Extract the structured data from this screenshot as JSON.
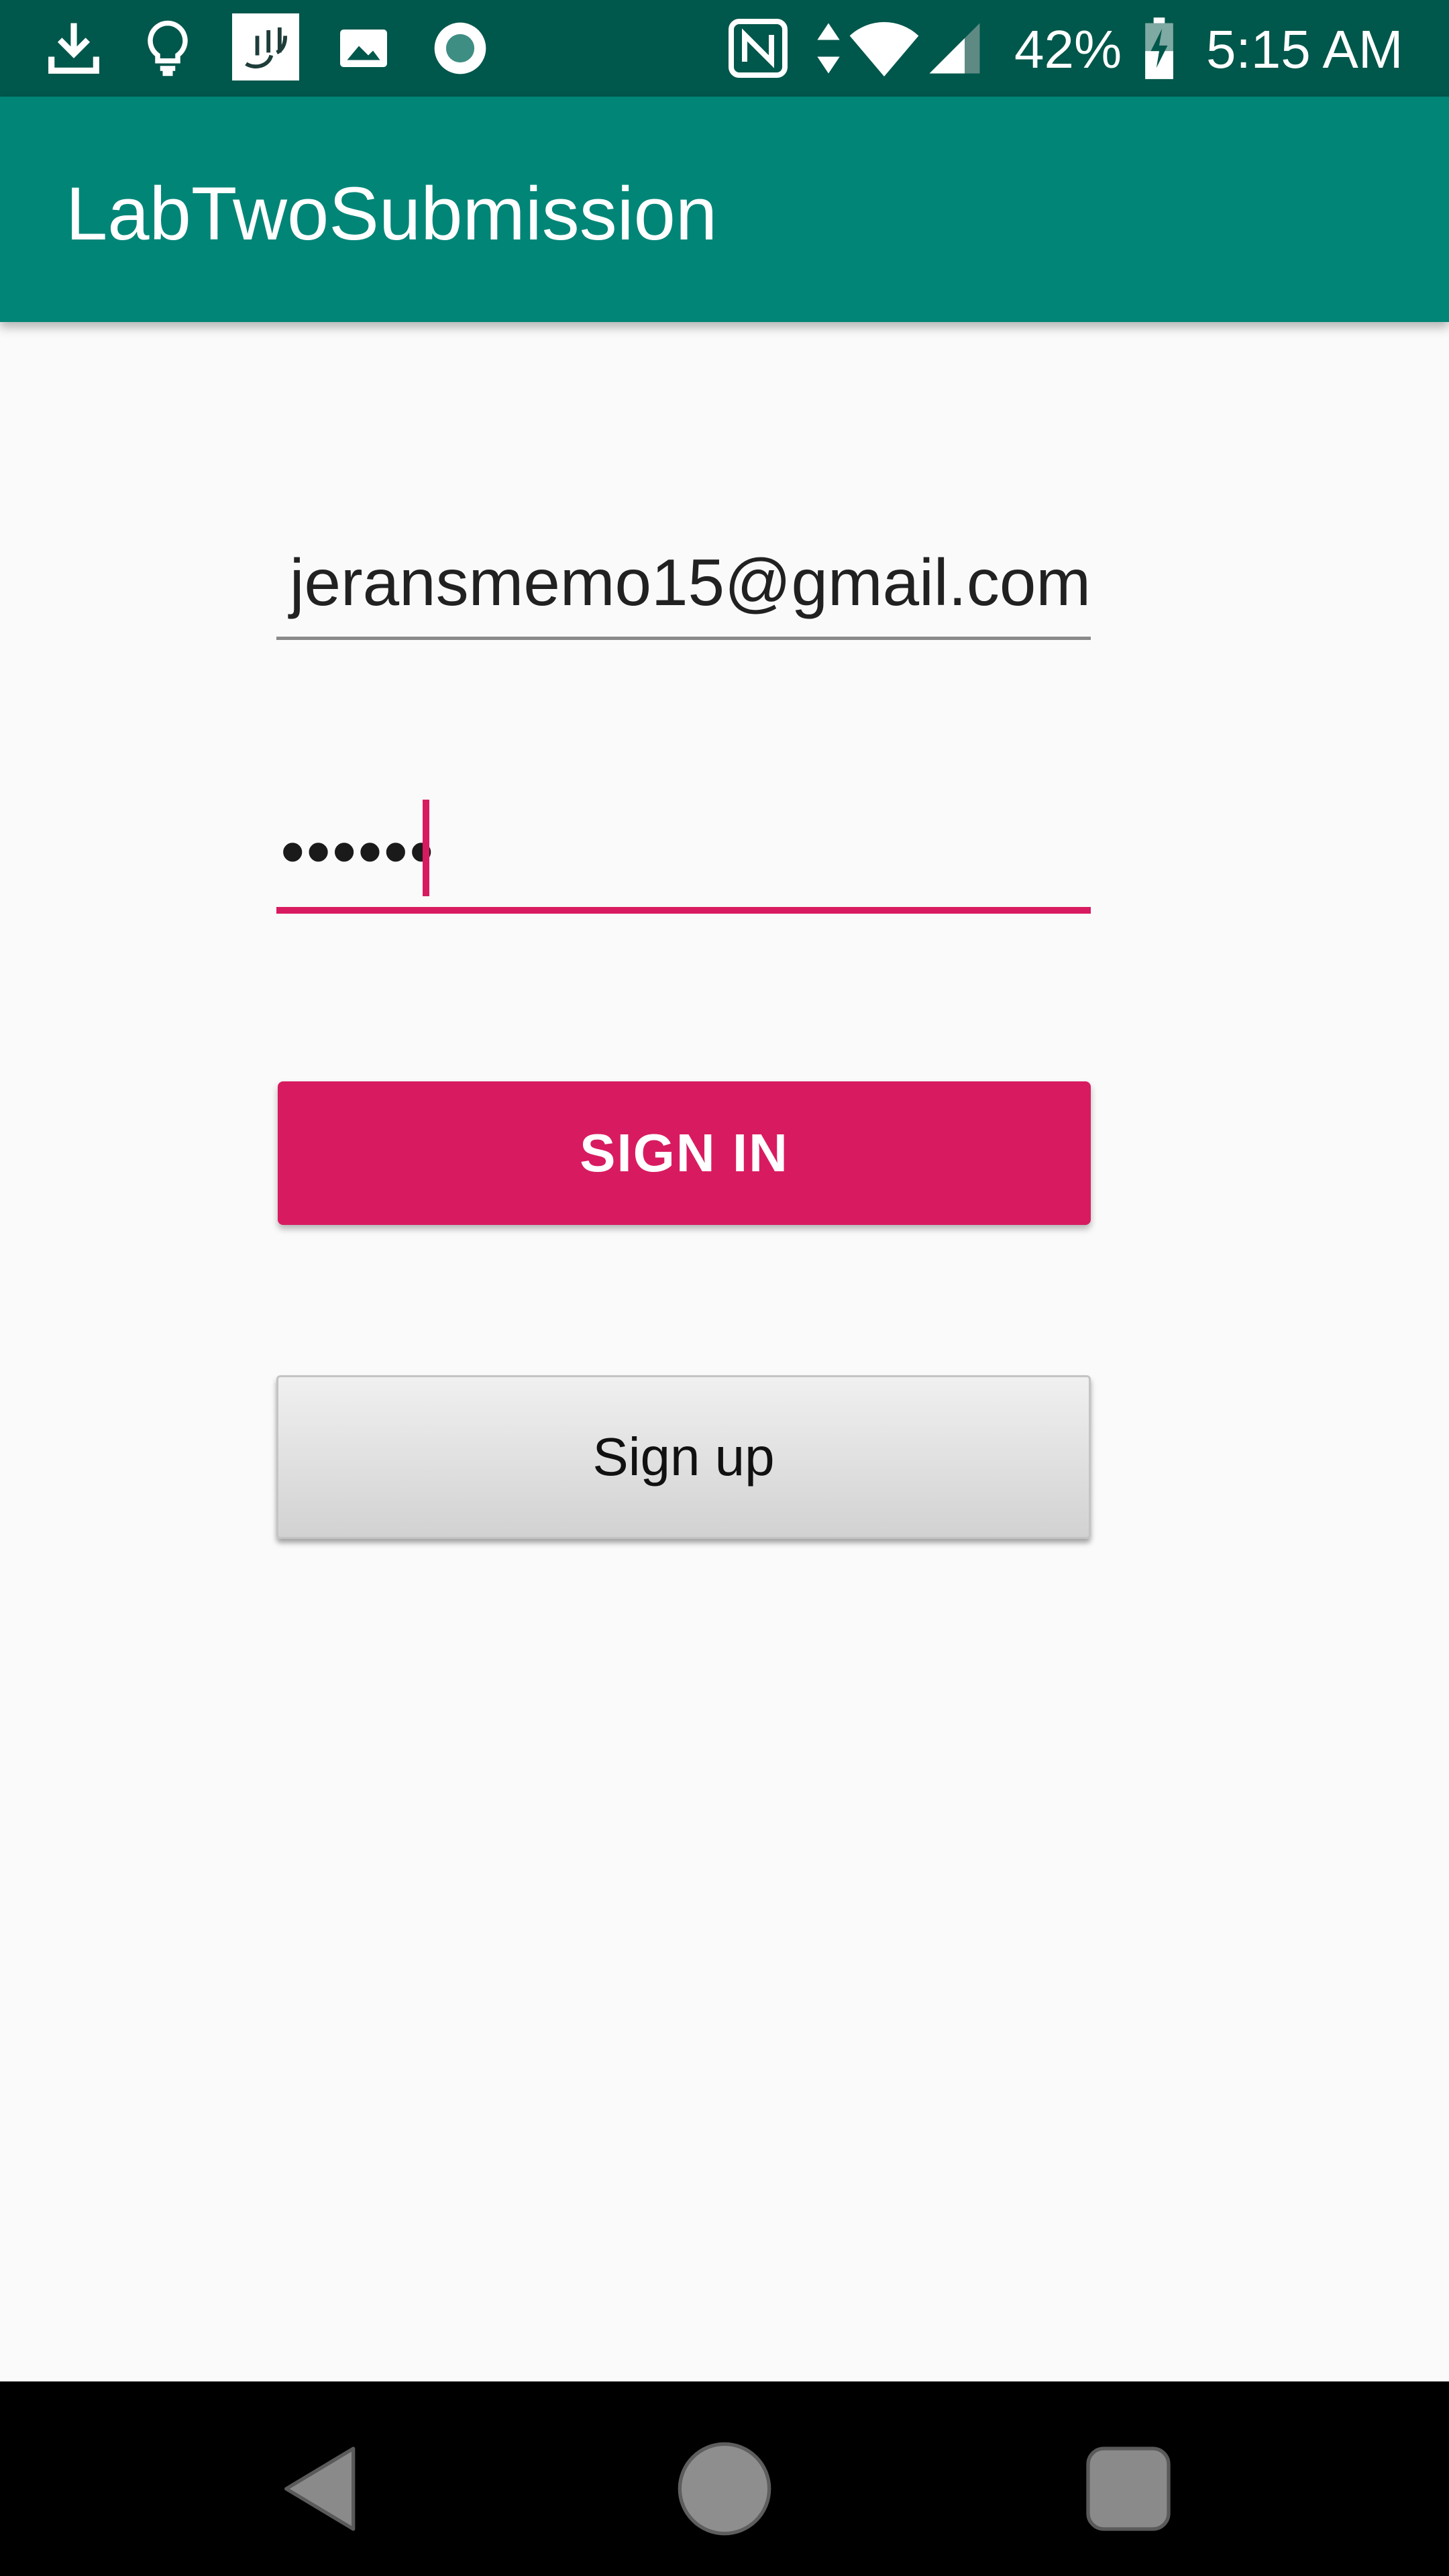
{
  "status_bar": {
    "icons": [
      "download-icon",
      "lightbulb-icon",
      "calligraphy-app-icon",
      "image-icon",
      "record-icon",
      "nfc-icon",
      "data-arrows-icon",
      "wifi-icon",
      "signal-icon",
      "battery-charging-icon"
    ],
    "battery": "42%",
    "time": "5:15 AM"
  },
  "app_bar": {
    "title": "LabTwoSubmission",
    "color": "#008577"
  },
  "form": {
    "email_value": "jeransmemo15@gmail.com",
    "password_value": "••••••",
    "sign_in_label": "SIGN IN",
    "sign_up_label": "Sign up"
  },
  "colors": {
    "accent": "#d81b60",
    "status_bar": "#00574b"
  },
  "nav_bar": {
    "icons": [
      "back-icon",
      "home-icon",
      "recents-icon"
    ]
  }
}
